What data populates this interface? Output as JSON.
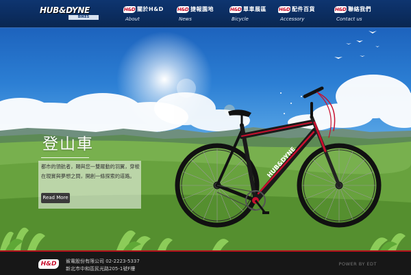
{
  "header": {
    "logo_text": "HUB&DYNE",
    "logo_sub": "BIKES",
    "nav": [
      {
        "badge": "H&D",
        "zh": "關於H&D",
        "en": "About"
      },
      {
        "badge": "H&D",
        "zh": "捷報園地",
        "en": "News"
      },
      {
        "badge": "H&D",
        "zh": "單車展區",
        "en": "Bicycle"
      },
      {
        "badge": "H&D",
        "zh": "配件百貨",
        "en": "Accessory"
      },
      {
        "badge": "H&D",
        "zh": "聯絡我們",
        "en": "Contact us"
      }
    ]
  },
  "hero": {
    "title": "登山車",
    "description": "都市的領航者，賜與您一雙躍動的羽翼，穿梭在現實與夢想之間，開創一條探索的道路。",
    "button_label": "Read More",
    "bike_frame_text": "HUB&DYNE"
  },
  "footer": {
    "logo_text": "H&D",
    "company": "鯊電股份有限公司 02-2223-5337",
    "address": "新北市中和區民光路205-1號F樓",
    "powered_by": "POWER BY EDT"
  },
  "colors": {
    "header_bg": "#0b2c5e",
    "brand_red": "#c8102e",
    "footer_bg": "#171717",
    "sky": "#2c7fd4",
    "grass": "#6aa24a"
  }
}
